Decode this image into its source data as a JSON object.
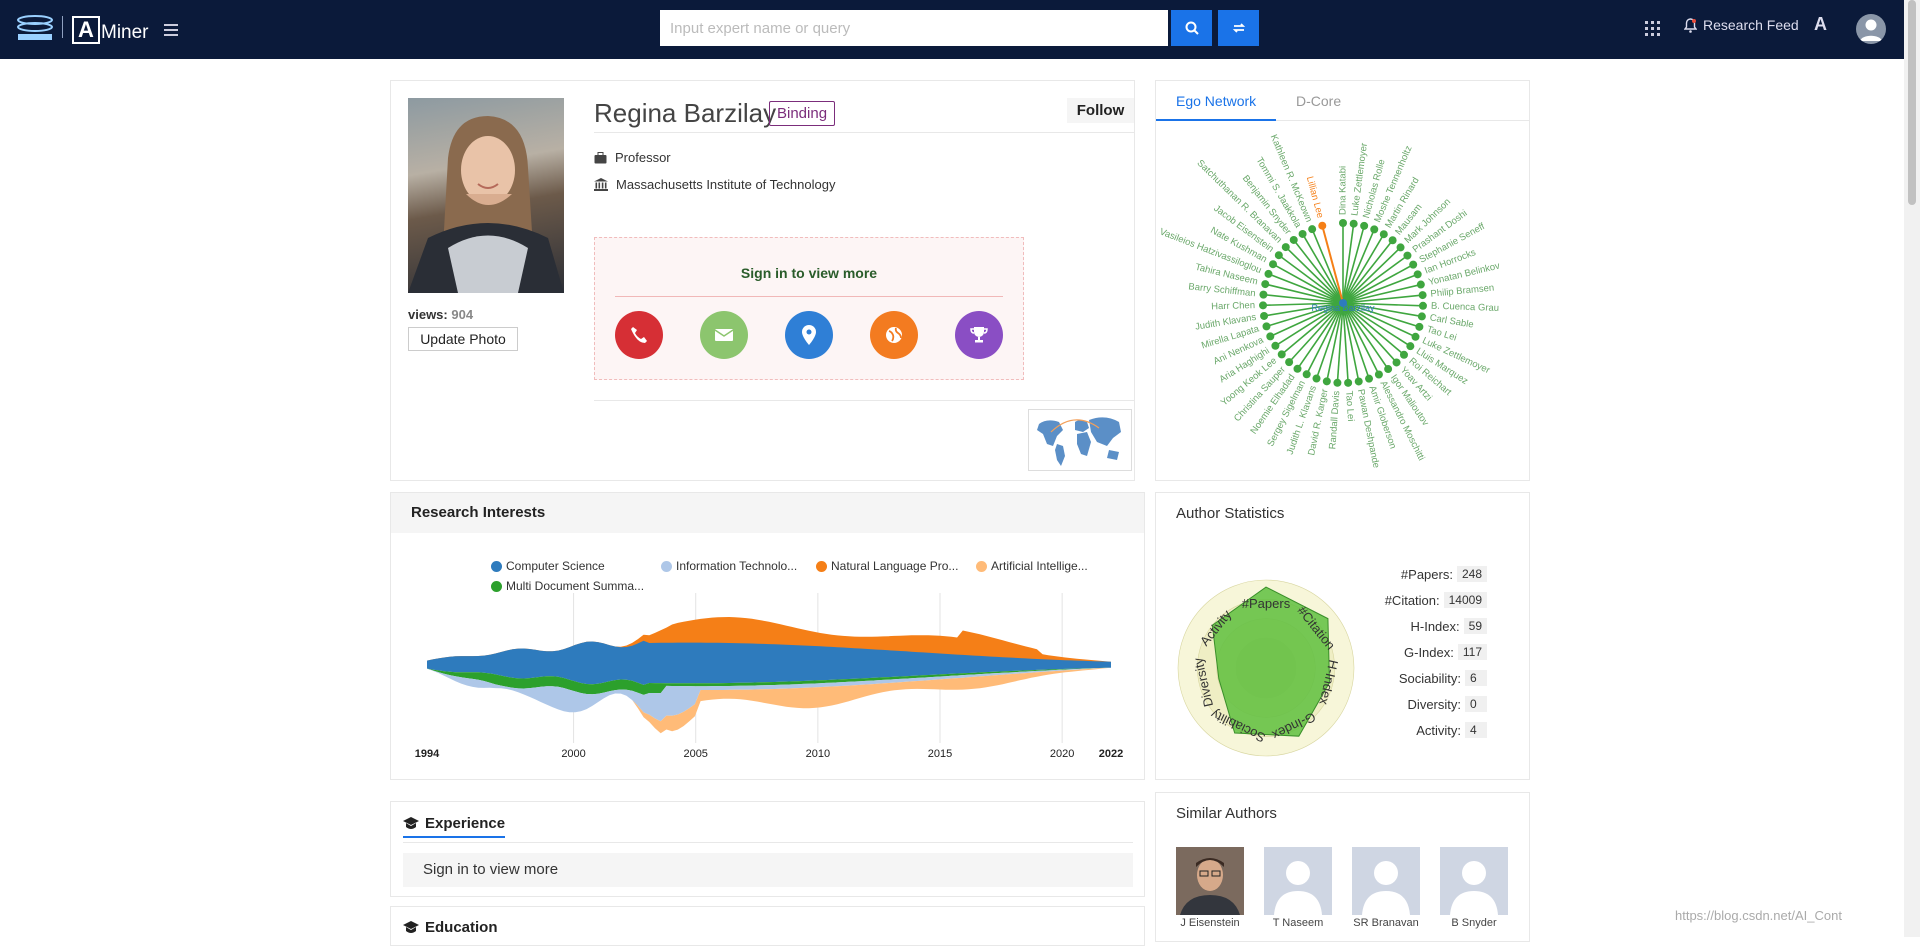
{
  "header": {
    "search_placeholder": "Input expert name or query",
    "research_feed": "Research Feed",
    "lang_icon_text": "A",
    "brand": "Miner",
    "brand_letter": "A"
  },
  "profile": {
    "name": "Regina Barzilay",
    "binding": "Binding",
    "follow": "Follow",
    "title": "Professor",
    "affiliation": "Massachusetts Institute of Technology",
    "views_label": "views:",
    "views": "904",
    "update_photo": "Update Photo",
    "sign_in": "Sign in to view more",
    "contact_icons": [
      {
        "name": "phone-icon",
        "color": "#d62f35"
      },
      {
        "name": "email-icon",
        "color": "#8cc56e"
      },
      {
        "name": "location-icon",
        "color": "#2f7fd6"
      },
      {
        "name": "homepage-icon",
        "color": "#f37b20"
      },
      {
        "name": "award-icon",
        "color": "#8a4ec4"
      }
    ]
  },
  "ego": {
    "tabs": [
      "Ego Network",
      "D-Core"
    ],
    "center": "Regina Barzilay",
    "names": [
      "Dina Katabi",
      "Luke Zettlemoyer",
      "Nicholas Rolle",
      "Moshe Tennenholtz",
      "Martin Rinard",
      "Mausam",
      "Mark Johnson",
      "Prashant Doshi",
      "Stephanie Seneff",
      "Ian Horrocks",
      "Yonatan Belinkov",
      "Philip Bramsen",
      "B. Cuenca Grau",
      "Carl Sable",
      "Tao Lei",
      "Luke Zettlemoyer",
      "Lluis Marquez",
      "Roi Reichart",
      "Yoav Artzi",
      "Igor Malioutov",
      "Alessandro Moschitti",
      "Amir Globerson",
      "Pawan Deshpande",
      "Tao Lei",
      "Randall Davis",
      "David R. Karger",
      "Judith L. Klavans",
      "Sergey Sigelman",
      "Noemie Elhadad",
      "Christina Sauper",
      "Yoong Keok Lee",
      "Aria Haghighi",
      "Ani Nenkova",
      "Mirella Lapata",
      "Judith Klavans",
      "Harr Chen",
      "Barry Schiffman",
      "Tahira Naseem",
      "Vasileios Hatzivassiloglou",
      "Nate Kushman",
      "Jacob Eisenstein",
      "Satchuthanan R. Branavan",
      "Benjamin Snyder",
      "Tommi S. Jaakkola",
      "Kathleen R. McKeown",
      "Lillian Lee"
    ],
    "highlight": "Lillian Lee"
  },
  "interests": {
    "title": "Research Interests",
    "legend": [
      {
        "label": "Computer Science",
        "color": "#2e7bbd"
      },
      {
        "label": "Information Technolo...",
        "color": "#aec7e8"
      },
      {
        "label": "Natural Language Pro...",
        "color": "#f57f17"
      },
      {
        "label": "Artificial Intellige...",
        "color": "#ffbb78"
      },
      {
        "label": "Multi Document Summa...",
        "color": "#2ca02c"
      }
    ],
    "years": [
      "1994",
      "2000",
      "2005",
      "2010",
      "2015",
      "2020",
      "2022"
    ]
  },
  "stats": {
    "title": "Author Statistics",
    "rows": [
      {
        "label": "#Papers:",
        "value": "248"
      },
      {
        "label": "#Citation:",
        "value": "14009"
      },
      {
        "label": "H-Index:",
        "value": "59"
      },
      {
        "label": "G-Index:",
        "value": "117"
      },
      {
        "label": "Sociability:",
        "value": "6"
      },
      {
        "label": "Diversity:",
        "value": "0"
      },
      {
        "label": "Activity:",
        "value": "4"
      }
    ],
    "radar_axes": [
      "#Papers",
      "#Citation",
      "H-Index",
      "G-Index",
      "Sociability",
      "Diversity",
      "Activity"
    ]
  },
  "experience": {
    "title": "Experience",
    "sign_in": "Sign in to view more"
  },
  "education": {
    "title": "Education"
  },
  "similar": {
    "title": "Similar Authors",
    "authors": [
      "J Eisenstein",
      "T Naseem",
      "SR Branavan",
      "B Snyder"
    ]
  },
  "watermark": "https://blog.csdn.net/AI_Cont"
}
